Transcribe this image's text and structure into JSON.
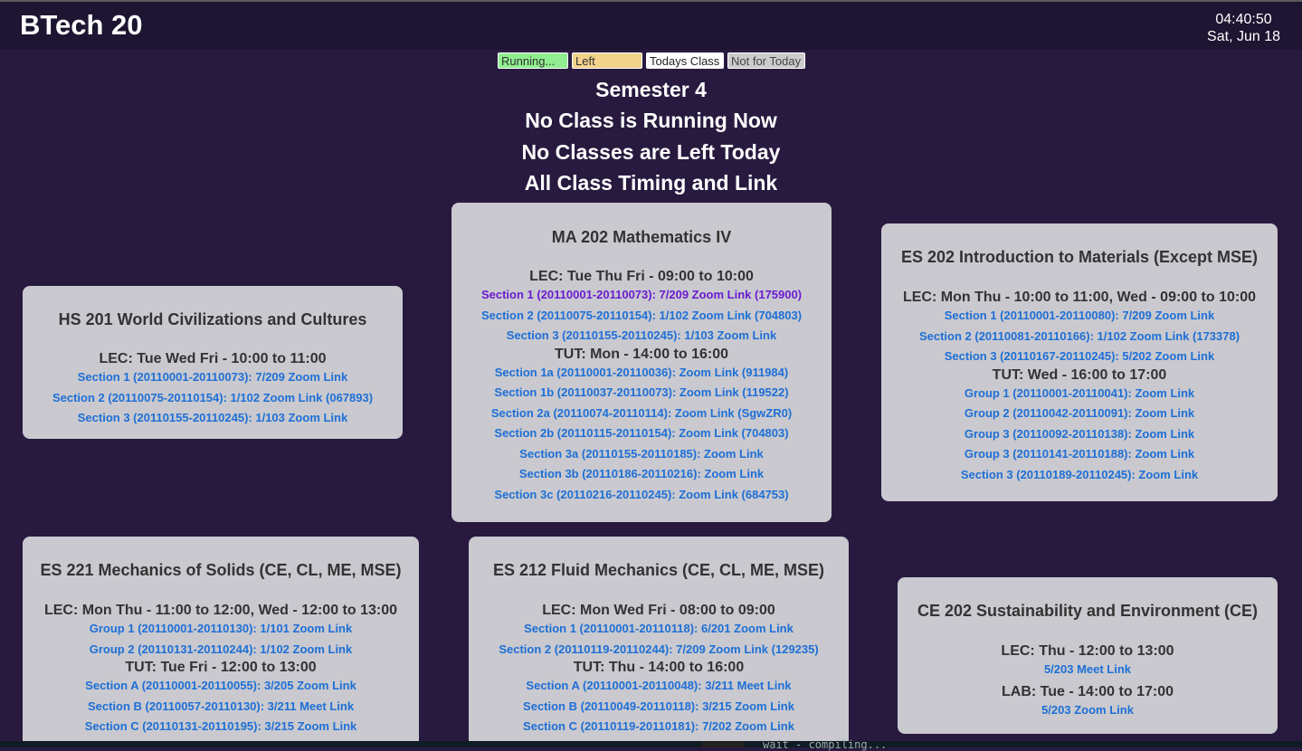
{
  "app": {
    "title": "BTech 20"
  },
  "clock": {
    "time": "04:40:50",
    "date": "Sat, Jun 18"
  },
  "legend": {
    "running": "Running...",
    "left": "Left",
    "today": "Todays Class",
    "not_today": "Not for Today"
  },
  "headings": {
    "semester": "Semester 4",
    "running": "No Class is Running Now",
    "left": "No Classes are Left Today",
    "all": "All Class Timing and Link"
  },
  "courses": [
    {
      "title": "HS 201 World Civilizations and Cultures",
      "blocks": [
        {
          "label": "LEC: Tue Wed Fri - 10:00 to 11:00",
          "links": [
            "Section 1 (20110001-20110073): 7/209 Zoom Link",
            "Section 2 (20110075-20110154): 1/102 Zoom Link (067893)",
            "Section 3 (20110155-20110245): 1/103 Zoom Link"
          ]
        }
      ]
    },
    {
      "title": "MA 202 Mathematics IV",
      "blocks": [
        {
          "label": "LEC: Tue Thu Fri - 09:00 to 10:00",
          "links": [
            "Section 1 (20110001-20110073): 7/209 Zoom Link (175900)",
            "Section 2 (20110075-20110154): 1/102 Zoom Link (704803)",
            "Section 3 (20110155-20110245): 1/103 Zoom Link"
          ]
        },
        {
          "label": "TUT: Mon - 14:00 to 16:00",
          "links": [
            "Section 1a (20110001-20110036): Zoom Link (911984)",
            "Section 1b (20110037-20110073): Zoom Link (119522)",
            "Section 2a (20110074-20110114): Zoom Link (SgwZR0)",
            "Section 2b (20110115-20110154): Zoom Link (704803)",
            "Section 3a (20110155-20110185): Zoom Link",
            "Section 3b (20110186-20110216): Zoom Link",
            "Section 3c (20110216-20110245): Zoom Link (684753)"
          ]
        }
      ]
    },
    {
      "title": "ES 202 Introduction to Materials (Except MSE)",
      "blocks": [
        {
          "label": "LEC: Mon Thu - 10:00 to 11:00, Wed - 09:00 to 10:00",
          "links": [
            "Section 1 (20110001-20110080): 7/209 Zoom Link",
            "Section 2 (20110081-20110166): 1/102 Zoom Link (173378)",
            "Section 3 (20110167-20110245): 5/202 Zoom Link"
          ]
        },
        {
          "label": "TUT: Wed - 16:00 to 17:00",
          "links": [
            "Group 1 (20110001-20110041): Zoom Link",
            "Group 2 (20110042-20110091): Zoom Link",
            "Group 3 (20110092-20110138): Zoom Link",
            "Group 3 (20110141-20110188): Zoom Link",
            "Section 3 (20110189-20110245): Zoom Link"
          ]
        }
      ]
    },
    {
      "title": "ES 221 Mechanics of Solids (CE, CL, ME, MSE)",
      "blocks": [
        {
          "label": "LEC: Mon Thu - 11:00 to 12:00, Wed - 12:00 to 13:00",
          "links": [
            "Group 1 (20110001-20110130): 1/101 Zoom Link",
            "Group 2 (20110131-20110244): 1/102 Zoom Link"
          ]
        },
        {
          "label": "TUT: Tue Fri - 12:00 to 13:00",
          "links": [
            "Section A (20110001-20110055): 3/205 Zoom Link",
            "Section B (20110057-20110130): 3/211 Meet Link",
            "Section C (20110131-20110195): 3/215 Zoom Link"
          ]
        }
      ]
    },
    {
      "title": "ES 212 Fluid Mechanics (CE, CL, ME, MSE)",
      "blocks": [
        {
          "label": "LEC: Mon Wed Fri - 08:00 to 09:00",
          "links": [
            "Section 1 (20110001-20110118): 6/201 Zoom Link",
            "Section 2 (20110119-20110244): 7/209 Zoom Link (129235)"
          ]
        },
        {
          "label": "TUT: Thu - 14:00 to 16:00",
          "links": [
            "Section A (20110001-20110048): 3/211 Meet Link",
            "Section B (20110049-20110118): 3/215 Zoom Link",
            "Section C (20110119-20110181): 7/202 Zoom Link"
          ]
        }
      ]
    },
    {
      "title": "CE 202 Sustainability and Environment (CE)",
      "blocks": [
        {
          "label": "LEC: Thu - 12:00 to 13:00",
          "links": [
            "5/203 Meet Link"
          ]
        },
        {
          "label": "LAB: Tue - 14:00 to 17:00",
          "links": [
            "5/203 Zoom Link"
          ]
        }
      ]
    }
  ],
  "terminal": {
    "text": "wait  - compiling..."
  }
}
